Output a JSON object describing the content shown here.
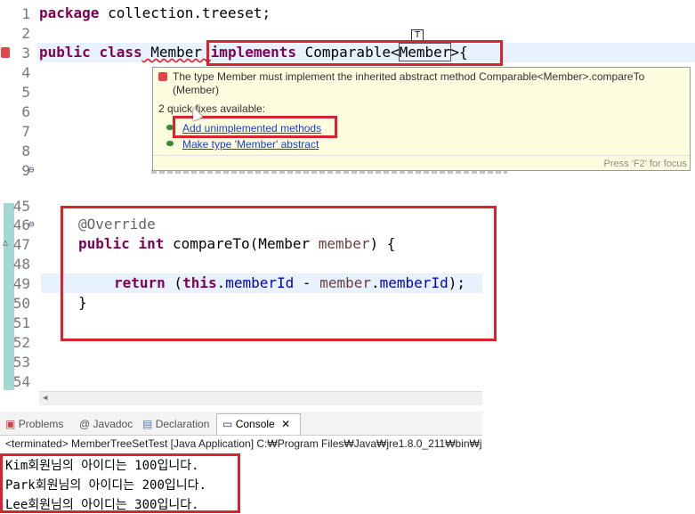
{
  "editor_top": {
    "lines": [
      {
        "num": "1",
        "text_pkg_kw": "package",
        "text_pkg_name": " collection.treeset;"
      },
      {
        "num": "2"
      },
      {
        "num": "3"
      },
      {
        "num": "4"
      },
      {
        "num": "5"
      },
      {
        "num": "6"
      },
      {
        "num": "7"
      },
      {
        "num": "8"
      },
      {
        "num": "9"
      }
    ],
    "line3": {
      "public": "public",
      "class": "class",
      "name": " Member ",
      "implements": "implements",
      "comparable": " Comparable",
      "lt": "<",
      "generic": "Member",
      ">": ">",
      "brace": "{"
    }
  },
  "popup": {
    "error_text": "The type Member must implement the inherited abstract method Comparable<Member>.compareTo",
    "error_text2": "(Member)",
    "quick_fixes": "2 quick fixes available:",
    "fix1": "Add unimplemented methods",
    "fix2": "Make type 'Member' abstract",
    "hint": "Press 'F2' for focus"
  },
  "editor_bottom": {
    "lines": [
      "45",
      "46",
      "47",
      "48",
      "49",
      "50",
      "51",
      "52",
      "53",
      "54"
    ],
    "override": "@Override",
    "sig_public": "public",
    "sig_int": "int",
    "sig_rest": " compareTo(Member ",
    "sig_param": "member",
    "sig_end": ") {",
    "ret": "return",
    "ret_open": " (",
    "ret_this": "this",
    "ret_dot": ".",
    "ret_field": "memberId",
    "ret_minus": " - ",
    "ret_var": "member",
    "ret_dot2": ".",
    "ret_field2": "memberId",
    "ret_end": ");",
    "close": "}"
  },
  "views": {
    "tabs": [
      "Problems",
      "Javadoc",
      "Declaration",
      "Console"
    ],
    "console_close": "✕",
    "terminated": "<terminated> MemberTreeSetTest [Java Application] C:₩Program Files₩Java₩jre1.8.0_211₩bin₩java"
  },
  "console": {
    "lines": [
      "Kim회원님의 아이디는 100입니다.",
      "Park회원님의 아이디는 200입니다.",
      "Lee회원님의 아이디는 300입니다."
    ]
  },
  "colors": {
    "highlight_box": "#d9232e",
    "keyword": "#7f0055",
    "field": "#0000c0",
    "link": "#1a3ec8"
  }
}
